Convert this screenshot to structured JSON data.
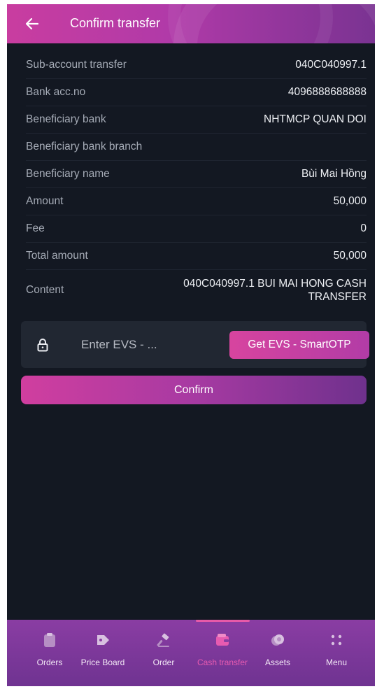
{
  "header": {
    "title": "Confirm transfer",
    "back_icon": "arrow-left-icon"
  },
  "details": {
    "rows": [
      {
        "label": "Sub-account transfer",
        "value": "040C040997.1"
      },
      {
        "label": "Bank acc.no",
        "value": "4096888688888"
      },
      {
        "label": "Beneficiary bank",
        "value": "NHTMCP QUAN DOI"
      },
      {
        "label": "Beneficiary bank branch",
        "value": ""
      },
      {
        "label": "Beneficiary name",
        "value": "Bùi Mai Hồng"
      },
      {
        "label": "Amount",
        "value": "50,000"
      },
      {
        "label": "Fee",
        "value": "0"
      },
      {
        "label": "Total amount",
        "value": "50,000"
      },
      {
        "label": "Content",
        "value": "040C040997.1 BUI MAI HONG CASH TRANSFER"
      }
    ]
  },
  "otp": {
    "placeholder": "Enter EVS - ...",
    "value": "",
    "button_label": "Get EVS - SmartOTP",
    "icon": "lock-icon"
  },
  "confirm_label": "Confirm",
  "bottom_nav": {
    "active": "Cash transfer",
    "items": [
      {
        "label": "Orders",
        "icon": "clipboard-icon"
      },
      {
        "label": "Price Board",
        "icon": "tag-icon"
      },
      {
        "label": "Order",
        "icon": "hammer-icon"
      },
      {
        "label": "Cash transfer",
        "icon": "wallet-icon"
      },
      {
        "label": "Assets",
        "icon": "coins-icon"
      },
      {
        "label": "Menu",
        "icon": "grid-icon"
      }
    ]
  },
  "colors": {
    "background": "#131822",
    "accent_pink": "#d03e9f",
    "accent_purple": "#6f318d",
    "nav_active": "#e75bb0"
  }
}
